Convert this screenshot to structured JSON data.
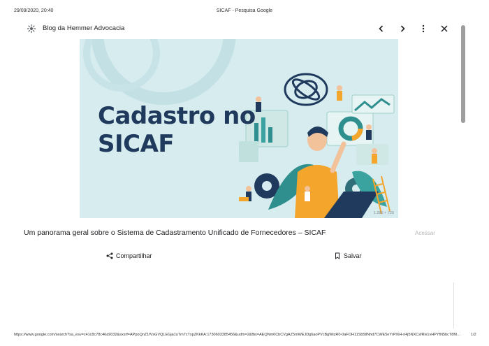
{
  "print_header": {
    "datetime": "29/09/2020, 20:40",
    "title": "SICAF - Pesquisa Google"
  },
  "panel": {
    "site_name": "Blog da Hemmer Advocacia",
    "icons": {
      "site": "site-favicon-icon",
      "prev": "chevron-left-icon",
      "next": "chevron-right-icon",
      "more": "more-vert-icon",
      "close": "close-icon"
    }
  },
  "hero": {
    "title_line1": "Cadastro no",
    "title_line2": "SICAF",
    "dimensions": "1.280 × 720"
  },
  "result": {
    "caption": "Um panorama geral sobre o Sistema de Cadastramento Unificado de Fornecedores – SICAF",
    "visit_label": "Acessar"
  },
  "actions": {
    "share_label": "Compartilhar",
    "save_label": "Salvar"
  },
  "print_footer": {
    "url": "https://www.google.com/search?sa_esv=c41c8c78c46a9032&sxsrf=APpoQnZ1fVsGVQLEGja1uTm7cTxpZKkKA:1730603385456&udm=2&fbs=AEQNm0CbCVgAZ5mWEJDg6aoPVcBgWizR0-0aFOH11Sb5tlNhd7CWE5eYrPlXH-n4j5NXCsfRlv1vHPYfN5bcT8MB&q=SICAF",
    "page": "1/2"
  },
  "colors": {
    "hero_bg": "#d6ecef",
    "title_navy": "#1f3a5c",
    "accent_orange": "#f4a52b",
    "accent_teal": "#2f8f8f"
  }
}
